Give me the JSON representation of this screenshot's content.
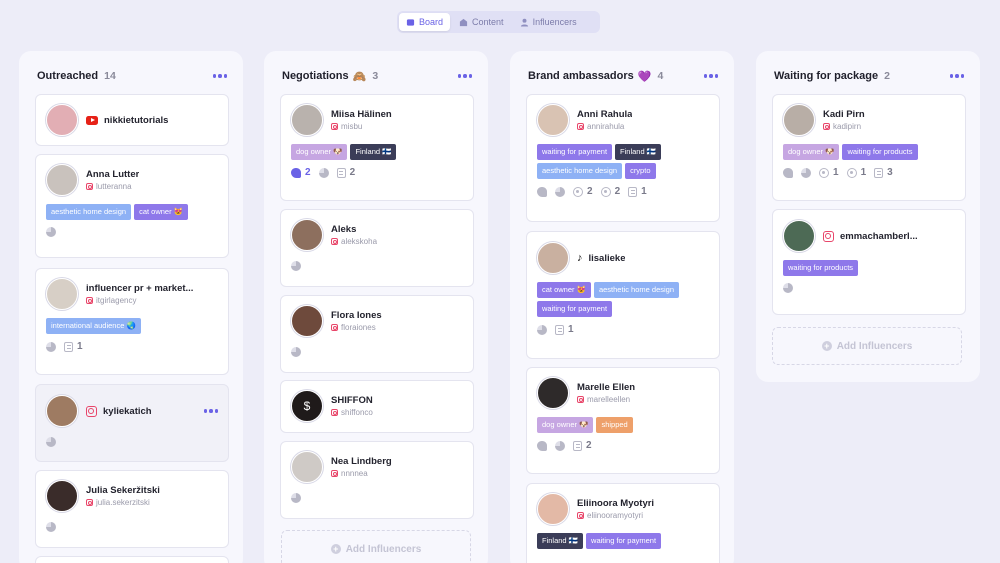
{
  "tabs": [
    {
      "label": "Board",
      "active": true
    },
    {
      "label": "Content",
      "active": false
    },
    {
      "label": "Influencers",
      "active": false
    }
  ],
  "colors": {
    "accent": "#6a62e6",
    "tag_purple": "#8e78ea",
    "tag_blue": "#8eb1f5",
    "tag_lilac": "#c6a6e2",
    "tag_dark": "#3b3d58",
    "tag_orange": "#eea06a",
    "instagram": "#e8466a",
    "youtube": "#e62117"
  },
  "add_label": "Add Influencers",
  "columns": [
    {
      "title": "Outreached",
      "emoji": "",
      "count": "14",
      "cards": [
        {
          "name": "nikkietutorials",
          "platform": "youtube",
          "inline": true,
          "tags": [],
          "stats": []
        },
        {
          "name": "Anna Lutter",
          "handle": "lutteranna",
          "tags": [
            {
              "label": "aesthetic home design",
              "color": "blue"
            },
            {
              "label": "cat owner 😻",
              "color": "purple"
            }
          ],
          "stats": [
            {
              "icon": "pie"
            }
          ]
        },
        {
          "name": "influencer pr + market...",
          "handle": "itgirlagency",
          "tags": [
            {
              "label": "international audience 🌏",
              "color": "blue"
            }
          ],
          "stats": [
            {
              "icon": "pie"
            },
            {
              "icon": "doc",
              "value": "1"
            }
          ]
        },
        {
          "name": "kyliekatich",
          "platform": "instagram",
          "inline": true,
          "highlight": true,
          "tags": [],
          "stats": [
            {
              "icon": "pie"
            }
          ]
        },
        {
          "name": "Julia Sekeržitski",
          "handle": "julia.sekerzitski",
          "tags": [],
          "stats": [
            {
              "icon": "pie"
            }
          ]
        }
      ]
    },
    {
      "title": "Negotiations",
      "emoji": "🙈",
      "count": "3",
      "cards": [
        {
          "name": "Miisa Hälinen",
          "handle": "misbu",
          "tags": [
            {
              "label": "dog owner 🐶",
              "color": "lilac"
            },
            {
              "label": "Finland 🇫🇮",
              "color": "dark"
            }
          ],
          "stats": [
            {
              "icon": "hand",
              "value": "2",
              "active": true
            },
            {
              "icon": "pie"
            },
            {
              "icon": "doc",
              "value": "2"
            }
          ]
        },
        {
          "name": "Aleks",
          "handle": "alekskoha",
          "tags": [],
          "stats": [
            {
              "icon": "pie"
            }
          ]
        },
        {
          "name": "Flora Iones",
          "handle": "floraiones",
          "tags": [],
          "stats": [
            {
              "icon": "pie"
            }
          ]
        },
        {
          "name": "SHIFFON",
          "handle": "shiffonco",
          "tags": [],
          "stats": []
        },
        {
          "name": "Nea Lindberg",
          "handle": "nnnnea",
          "tags": [],
          "stats": [
            {
              "icon": "pie"
            }
          ]
        }
      ]
    },
    {
      "title": "Brand ambassadors",
      "emoji": "💜",
      "count": "4",
      "cards": [
        {
          "name": "Anni Rahula",
          "handle": "annirahula",
          "tags": [
            {
              "label": "waiting for payment",
              "color": "purple"
            },
            {
              "label": "Finland 🇫🇮",
              "color": "dark"
            },
            {
              "label": "aesthetic home design",
              "color": "blue"
            },
            {
              "label": "crypto",
              "color": "purple"
            }
          ],
          "stats": [
            {
              "icon": "hand"
            },
            {
              "icon": "pie"
            },
            {
              "icon": "circ",
              "value": "2"
            },
            {
              "icon": "circ",
              "value": "2"
            },
            {
              "icon": "doc",
              "value": "1"
            }
          ]
        },
        {
          "name": "lisalieke",
          "platform": "tiktok",
          "inline": true,
          "tags": [
            {
              "label": "cat owner 😻",
              "color": "purple"
            },
            {
              "label": "aesthetic home design",
              "color": "blue"
            },
            {
              "label": "waiting for payment",
              "color": "purple"
            }
          ],
          "stats": [
            {
              "icon": "pie"
            },
            {
              "icon": "doc",
              "value": "1"
            }
          ]
        },
        {
          "name": "Marelle Ellen",
          "handle": "marelleellen",
          "tags": [
            {
              "label": "dog owner 🐶",
              "color": "lilac"
            },
            {
              "label": "shipped",
              "color": "orange"
            }
          ],
          "stats": [
            {
              "icon": "hand"
            },
            {
              "icon": "pie"
            },
            {
              "icon": "doc",
              "value": "2"
            }
          ]
        },
        {
          "name": "Eliinoora Myotyri",
          "handle": "eliinooramyotyri",
          "tags": [
            {
              "label": "Finland 🇫🇮",
              "color": "dark"
            },
            {
              "label": "waiting for payment",
              "color": "purple"
            }
          ],
          "stats": []
        }
      ]
    },
    {
      "title": "Waiting for package",
      "emoji": "",
      "count": "2",
      "cards": [
        {
          "name": "Kadi Pirn",
          "handle": "kadipirn",
          "tags": [
            {
              "label": "dog owner 🐶",
              "color": "lilac"
            },
            {
              "label": "waiting for products",
              "color": "purple"
            }
          ],
          "stats": [
            {
              "icon": "hand"
            },
            {
              "icon": "pie"
            },
            {
              "icon": "circ",
              "value": "1"
            },
            {
              "icon": "circ",
              "value": "1"
            },
            {
              "icon": "doc",
              "value": "3"
            }
          ]
        },
        {
          "name": "emmachamberl...",
          "platform": "instagram",
          "inline": true,
          "tags": [
            {
              "label": "waiting for products",
              "color": "purple"
            }
          ],
          "stats": [
            {
              "icon": "pie"
            }
          ]
        }
      ]
    }
  ]
}
